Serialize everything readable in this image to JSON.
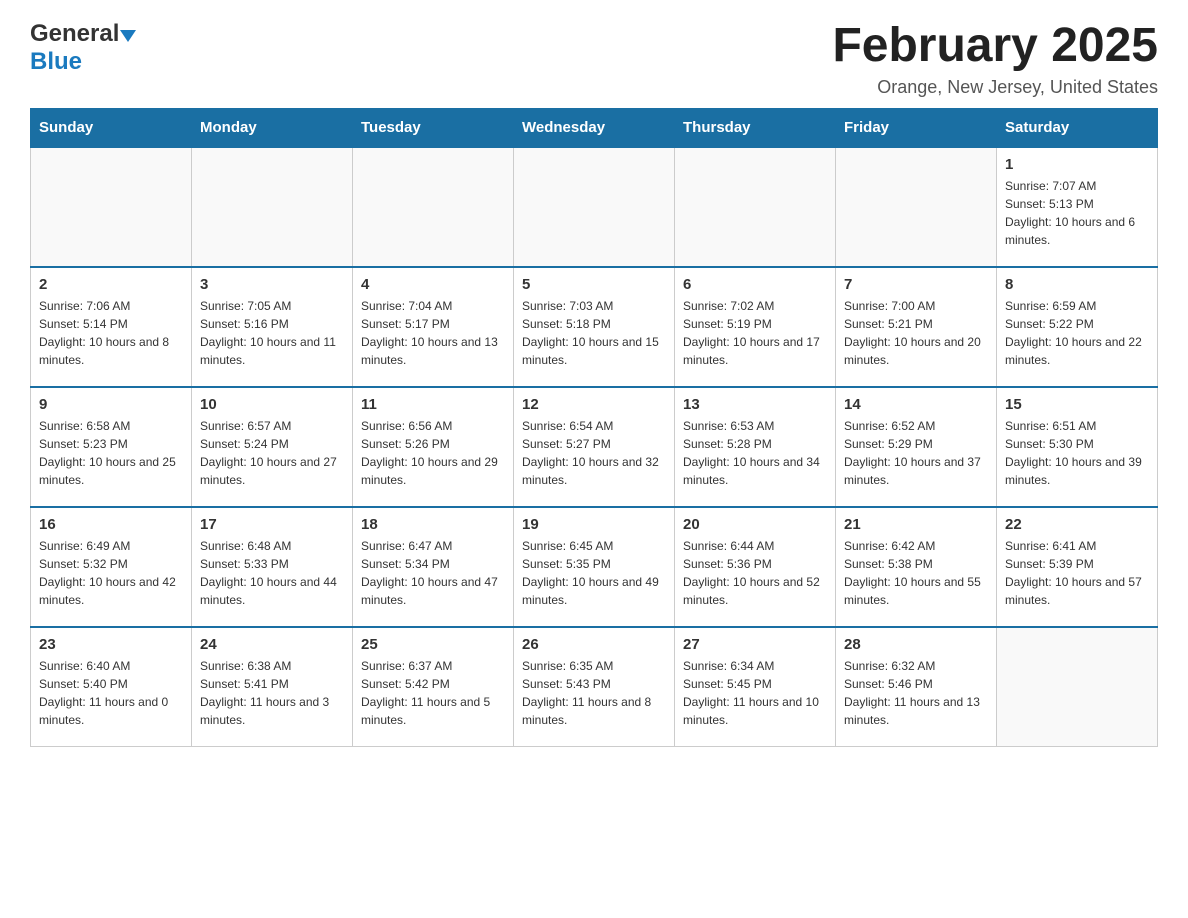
{
  "header": {
    "logo_general": "General",
    "logo_blue": "Blue",
    "month_title": "February 2025",
    "location": "Orange, New Jersey, United States"
  },
  "weekdays": [
    "Sunday",
    "Monday",
    "Tuesday",
    "Wednesday",
    "Thursday",
    "Friday",
    "Saturday"
  ],
  "weeks": [
    [
      {
        "day": "",
        "sunrise": "",
        "sunset": "",
        "daylight": ""
      },
      {
        "day": "",
        "sunrise": "",
        "sunset": "",
        "daylight": ""
      },
      {
        "day": "",
        "sunrise": "",
        "sunset": "",
        "daylight": ""
      },
      {
        "day": "",
        "sunrise": "",
        "sunset": "",
        "daylight": ""
      },
      {
        "day": "",
        "sunrise": "",
        "sunset": "",
        "daylight": ""
      },
      {
        "day": "",
        "sunrise": "",
        "sunset": "",
        "daylight": ""
      },
      {
        "day": "1",
        "sunrise": "Sunrise: 7:07 AM",
        "sunset": "Sunset: 5:13 PM",
        "daylight": "Daylight: 10 hours and 6 minutes."
      }
    ],
    [
      {
        "day": "2",
        "sunrise": "Sunrise: 7:06 AM",
        "sunset": "Sunset: 5:14 PM",
        "daylight": "Daylight: 10 hours and 8 minutes."
      },
      {
        "day": "3",
        "sunrise": "Sunrise: 7:05 AM",
        "sunset": "Sunset: 5:16 PM",
        "daylight": "Daylight: 10 hours and 11 minutes."
      },
      {
        "day": "4",
        "sunrise": "Sunrise: 7:04 AM",
        "sunset": "Sunset: 5:17 PM",
        "daylight": "Daylight: 10 hours and 13 minutes."
      },
      {
        "day": "5",
        "sunrise": "Sunrise: 7:03 AM",
        "sunset": "Sunset: 5:18 PM",
        "daylight": "Daylight: 10 hours and 15 minutes."
      },
      {
        "day": "6",
        "sunrise": "Sunrise: 7:02 AM",
        "sunset": "Sunset: 5:19 PM",
        "daylight": "Daylight: 10 hours and 17 minutes."
      },
      {
        "day": "7",
        "sunrise": "Sunrise: 7:00 AM",
        "sunset": "Sunset: 5:21 PM",
        "daylight": "Daylight: 10 hours and 20 minutes."
      },
      {
        "day": "8",
        "sunrise": "Sunrise: 6:59 AM",
        "sunset": "Sunset: 5:22 PM",
        "daylight": "Daylight: 10 hours and 22 minutes."
      }
    ],
    [
      {
        "day": "9",
        "sunrise": "Sunrise: 6:58 AM",
        "sunset": "Sunset: 5:23 PM",
        "daylight": "Daylight: 10 hours and 25 minutes."
      },
      {
        "day": "10",
        "sunrise": "Sunrise: 6:57 AM",
        "sunset": "Sunset: 5:24 PM",
        "daylight": "Daylight: 10 hours and 27 minutes."
      },
      {
        "day": "11",
        "sunrise": "Sunrise: 6:56 AM",
        "sunset": "Sunset: 5:26 PM",
        "daylight": "Daylight: 10 hours and 29 minutes."
      },
      {
        "day": "12",
        "sunrise": "Sunrise: 6:54 AM",
        "sunset": "Sunset: 5:27 PM",
        "daylight": "Daylight: 10 hours and 32 minutes."
      },
      {
        "day": "13",
        "sunrise": "Sunrise: 6:53 AM",
        "sunset": "Sunset: 5:28 PM",
        "daylight": "Daylight: 10 hours and 34 minutes."
      },
      {
        "day": "14",
        "sunrise": "Sunrise: 6:52 AM",
        "sunset": "Sunset: 5:29 PM",
        "daylight": "Daylight: 10 hours and 37 minutes."
      },
      {
        "day": "15",
        "sunrise": "Sunrise: 6:51 AM",
        "sunset": "Sunset: 5:30 PM",
        "daylight": "Daylight: 10 hours and 39 minutes."
      }
    ],
    [
      {
        "day": "16",
        "sunrise": "Sunrise: 6:49 AM",
        "sunset": "Sunset: 5:32 PM",
        "daylight": "Daylight: 10 hours and 42 minutes."
      },
      {
        "day": "17",
        "sunrise": "Sunrise: 6:48 AM",
        "sunset": "Sunset: 5:33 PM",
        "daylight": "Daylight: 10 hours and 44 minutes."
      },
      {
        "day": "18",
        "sunrise": "Sunrise: 6:47 AM",
        "sunset": "Sunset: 5:34 PM",
        "daylight": "Daylight: 10 hours and 47 minutes."
      },
      {
        "day": "19",
        "sunrise": "Sunrise: 6:45 AM",
        "sunset": "Sunset: 5:35 PM",
        "daylight": "Daylight: 10 hours and 49 minutes."
      },
      {
        "day": "20",
        "sunrise": "Sunrise: 6:44 AM",
        "sunset": "Sunset: 5:36 PM",
        "daylight": "Daylight: 10 hours and 52 minutes."
      },
      {
        "day": "21",
        "sunrise": "Sunrise: 6:42 AM",
        "sunset": "Sunset: 5:38 PM",
        "daylight": "Daylight: 10 hours and 55 minutes."
      },
      {
        "day": "22",
        "sunrise": "Sunrise: 6:41 AM",
        "sunset": "Sunset: 5:39 PM",
        "daylight": "Daylight: 10 hours and 57 minutes."
      }
    ],
    [
      {
        "day": "23",
        "sunrise": "Sunrise: 6:40 AM",
        "sunset": "Sunset: 5:40 PM",
        "daylight": "Daylight: 11 hours and 0 minutes."
      },
      {
        "day": "24",
        "sunrise": "Sunrise: 6:38 AM",
        "sunset": "Sunset: 5:41 PM",
        "daylight": "Daylight: 11 hours and 3 minutes."
      },
      {
        "day": "25",
        "sunrise": "Sunrise: 6:37 AM",
        "sunset": "Sunset: 5:42 PM",
        "daylight": "Daylight: 11 hours and 5 minutes."
      },
      {
        "day": "26",
        "sunrise": "Sunrise: 6:35 AM",
        "sunset": "Sunset: 5:43 PM",
        "daylight": "Daylight: 11 hours and 8 minutes."
      },
      {
        "day": "27",
        "sunrise": "Sunrise: 6:34 AM",
        "sunset": "Sunset: 5:45 PM",
        "daylight": "Daylight: 11 hours and 10 minutes."
      },
      {
        "day": "28",
        "sunrise": "Sunrise: 6:32 AM",
        "sunset": "Sunset: 5:46 PM",
        "daylight": "Daylight: 11 hours and 13 minutes."
      },
      {
        "day": "",
        "sunrise": "",
        "sunset": "",
        "daylight": ""
      }
    ]
  ]
}
